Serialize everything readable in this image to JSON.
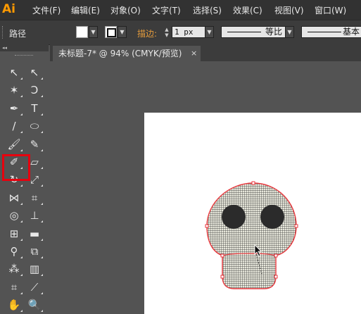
{
  "app": {
    "logo": "Ai"
  },
  "menu": [
    "文件(F)",
    "编辑(E)",
    "对象(O)",
    "文字(T)",
    "选择(S)",
    "效果(C)",
    "视图(V)",
    "窗口(W)"
  ],
  "control_bar": {
    "selection_label": "路径",
    "stroke_label": "描边:",
    "stroke_width": "1 px",
    "stroke_profile": "等比",
    "brush_profile": "基本"
  },
  "toolbar": {
    "collapse": "◂◂",
    "tools": [
      {
        "name": "selection-tool",
        "glyph": "↖"
      },
      {
        "name": "direct-selection-tool",
        "glyph": "↖"
      },
      {
        "name": "magic-wand-tool",
        "glyph": "✶"
      },
      {
        "name": "lasso-tool",
        "glyph": "Ↄ"
      },
      {
        "name": "pen-tool",
        "glyph": "✒"
      },
      {
        "name": "type-tool",
        "glyph": "T"
      },
      {
        "name": "line-segment-tool",
        "glyph": "/"
      },
      {
        "name": "ellipse-tool",
        "glyph": "⬭"
      },
      {
        "name": "paintbrush-tool",
        "glyph": "🖌"
      },
      {
        "name": "pencil-tool",
        "glyph": "✎"
      },
      {
        "name": "blob-brush-tool",
        "glyph": "✐"
      },
      {
        "name": "eraser-tool",
        "glyph": "▱"
      },
      {
        "name": "rotate-tool",
        "glyph": "↻"
      },
      {
        "name": "scale-tool",
        "glyph": "⤢"
      },
      {
        "name": "width-tool",
        "glyph": "⋈"
      },
      {
        "name": "free-transform-tool",
        "glyph": "⌗"
      },
      {
        "name": "shape-builder-tool",
        "glyph": "◎"
      },
      {
        "name": "perspective-grid-tool",
        "glyph": "⊥"
      },
      {
        "name": "mesh-tool",
        "glyph": "⊞"
      },
      {
        "name": "gradient-tool",
        "glyph": "▬"
      },
      {
        "name": "eyedropper-tool",
        "glyph": "⚲"
      },
      {
        "name": "blend-tool",
        "glyph": "⧉"
      },
      {
        "name": "symbol-sprayer-tool",
        "glyph": "⁂"
      },
      {
        "name": "column-graph-tool",
        "glyph": "▥"
      },
      {
        "name": "artboard-tool",
        "glyph": "⌗"
      },
      {
        "name": "slice-tool",
        "glyph": "⟋"
      },
      {
        "name": "hand-tool",
        "glyph": "✋"
      },
      {
        "name": "zoom-tool",
        "glyph": "🔍"
      }
    ]
  },
  "document": {
    "tab_title": "未标题-7* @ 94% (CMYK/预览)",
    "close": "×"
  },
  "colors": {
    "selection": "#e8363c",
    "highlight": "#e8000e",
    "fill": "#ffffff"
  }
}
